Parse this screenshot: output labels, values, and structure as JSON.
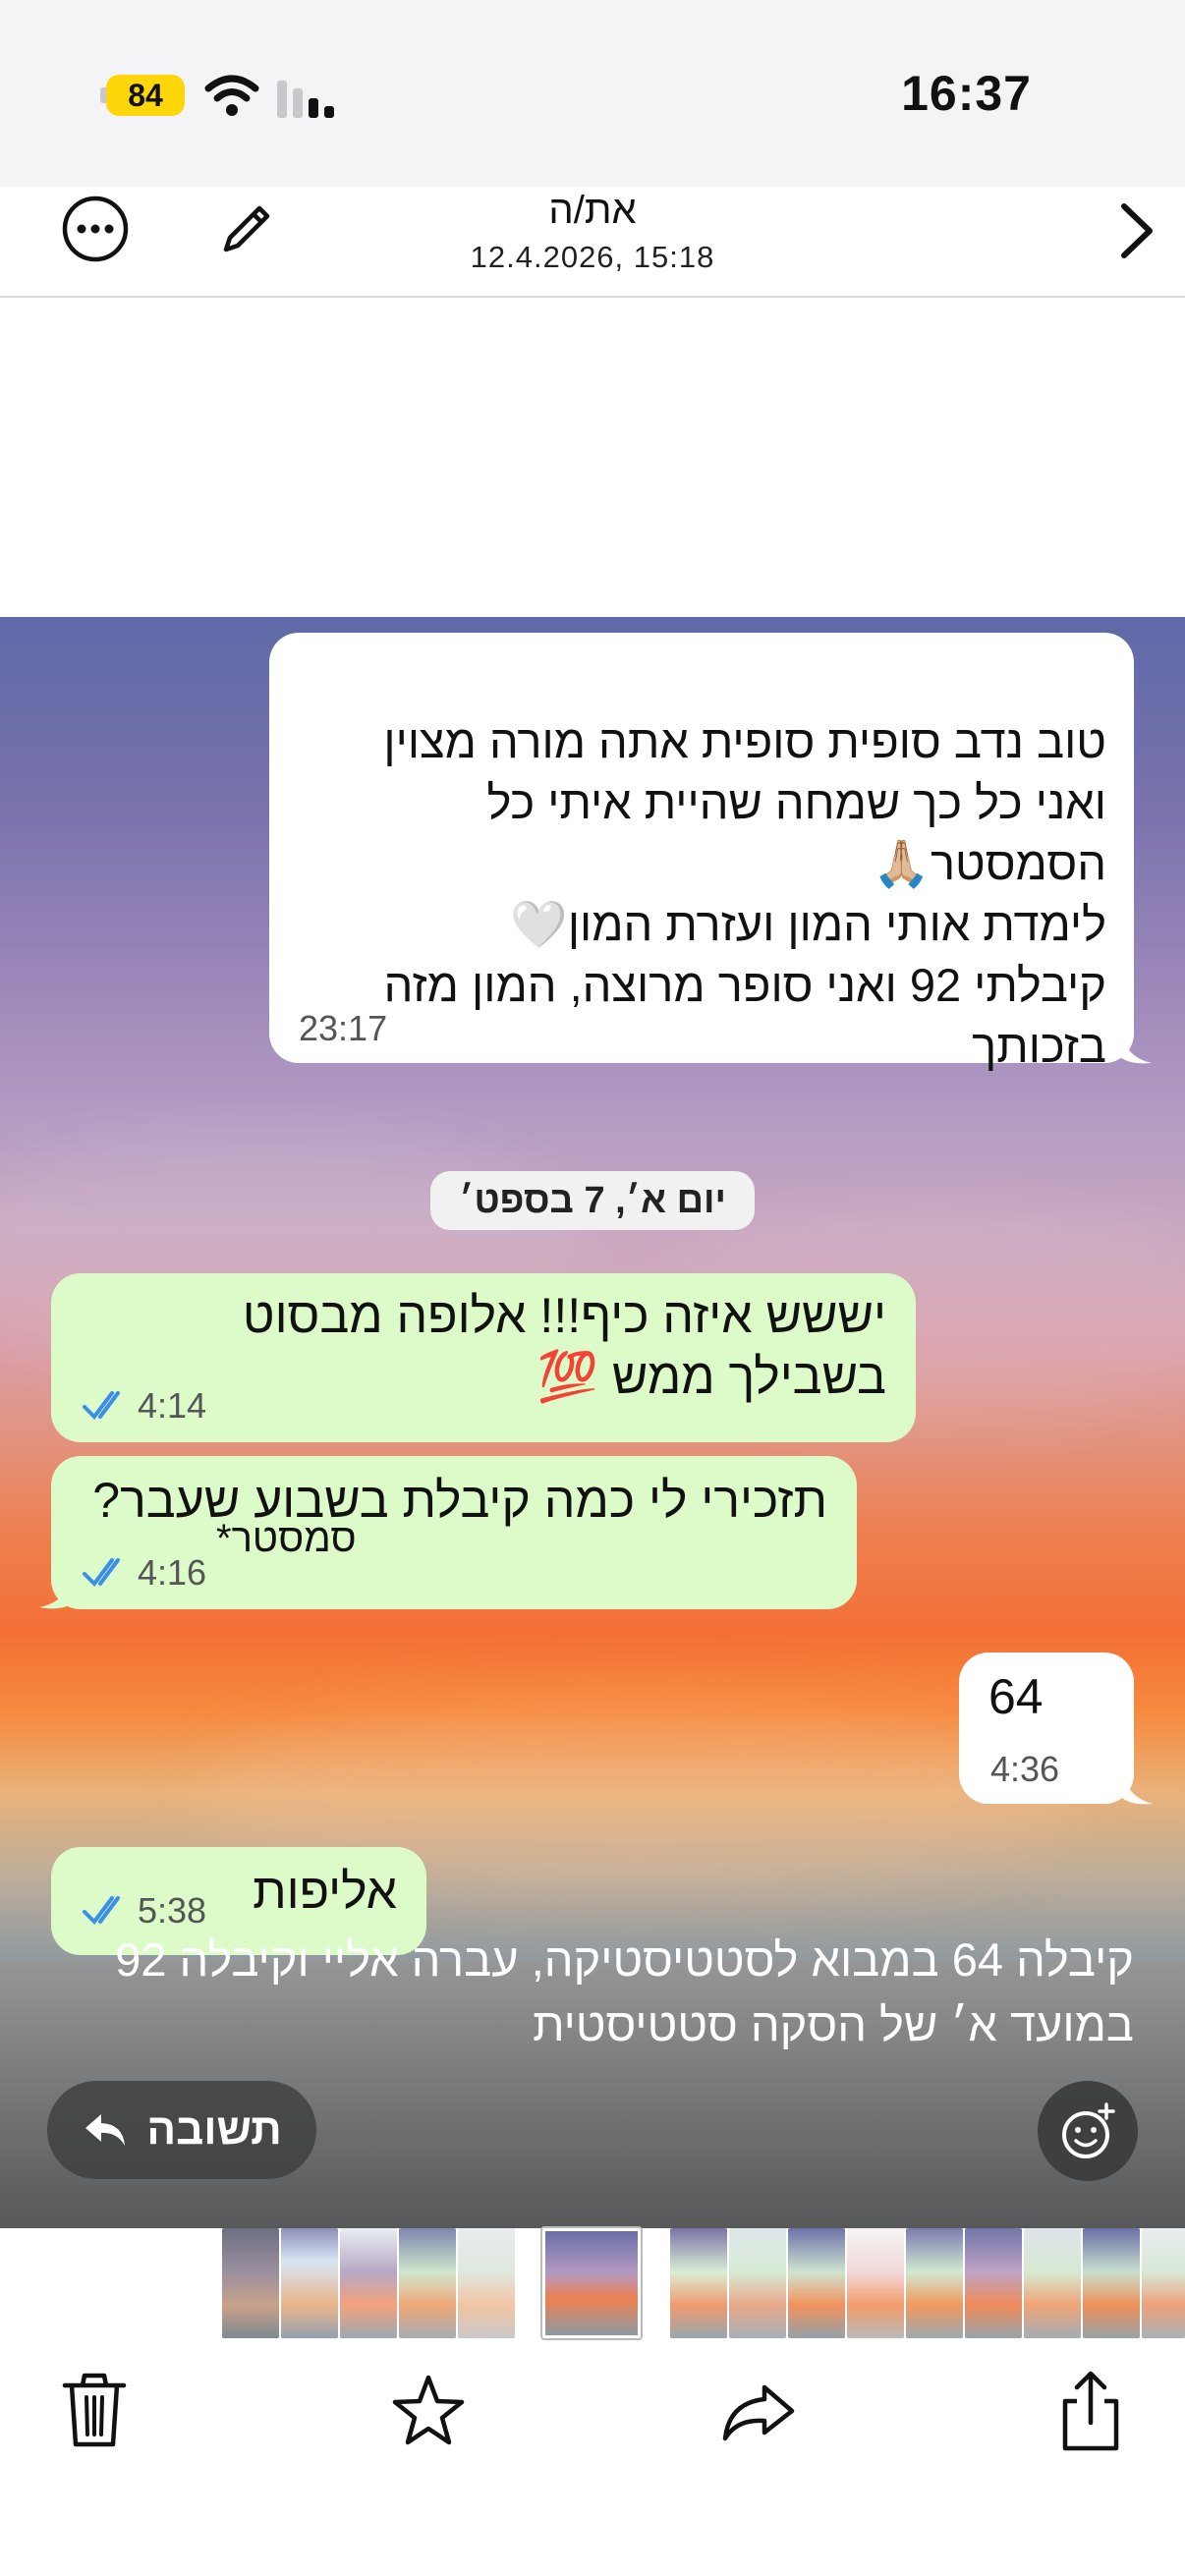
{
  "status_bar": {
    "battery": "84",
    "time": "16:37"
  },
  "header": {
    "title": "את/ה",
    "subtitle": "12.4.2026, 15:18"
  },
  "chat": {
    "messages": [
      {
        "side": "incoming",
        "text": "טוב נדב סופית סופית אתה מורה מצוין ואני כל כך שמחה שהיית איתי כל הסמסטר🙏🏼\nלימדת אותי המון ועזרת המון🤍\nקיבלתי 92 ואני סופר מרוצה, המון מזה בזכותך",
        "time": "23:17"
      },
      {
        "side": "outgoing",
        "text": "יששש איזה כיף!!! אלופה מבסוט בשבילך ממש 💯",
        "time": "4:14"
      },
      {
        "side": "outgoing",
        "text": "תזכירי לי כמה קיבלת בשבוע שעבר?",
        "correction": "סמסטר*",
        "time": "4:16"
      },
      {
        "side": "incoming",
        "text": "64",
        "time": "4:36"
      },
      {
        "side": "outgoing",
        "text": "אליפות",
        "time": "5:38"
      }
    ],
    "date_separator": "יום א׳, 7 בספט׳"
  },
  "caption": {
    "text": "קיבלה 64 במבוא לסטטיסטיקה, עברה אליי וקיבלה 92 במועד א׳ של הסקה סטטיסטית"
  },
  "actions": {
    "reply_label": "תשובה"
  },
  "icons": {
    "more": "ellipsis-circle-icon",
    "edit": "pencil-icon",
    "next": "chevron-right-icon",
    "reply": "reply-arrow-icon",
    "emoji": "add-reaction-icon",
    "delete": "trash-icon",
    "favorite": "star-icon",
    "forward": "forward-arrow-icon",
    "share": "share-icon"
  },
  "colors": {
    "incoming_bubble": "#ffffff",
    "outgoing_bubble": "#dcfbc9",
    "read_ticks": "#3b8fe8",
    "battery": "#ffd60a"
  }
}
